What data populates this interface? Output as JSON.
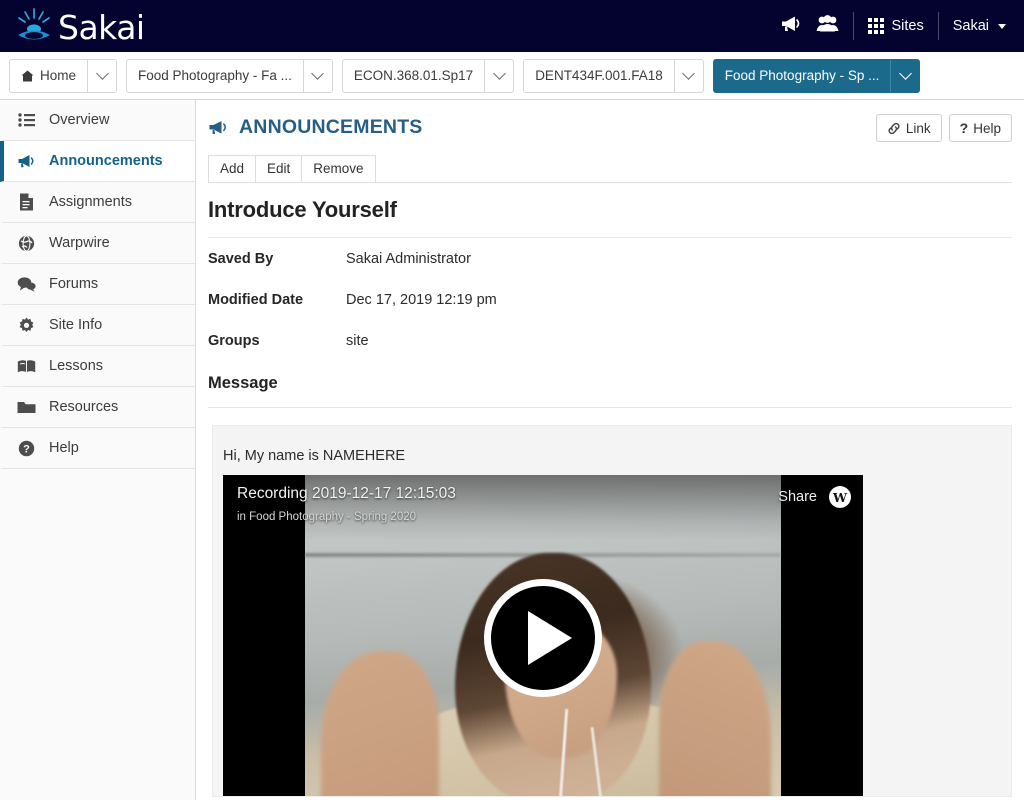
{
  "header": {
    "brand": "Sakai",
    "icons": [
      {
        "name": "announcements-icon",
        "glyph": "megaphone"
      },
      {
        "name": "groups-icon",
        "glyph": "people"
      }
    ],
    "sites_label": "Sites",
    "user_label": "Sakai"
  },
  "site_tabs": [
    {
      "label": "Home",
      "icon": "home-icon",
      "active": false
    },
    {
      "label": "Food Photography - Fa ...",
      "icon": null,
      "active": false
    },
    {
      "label": "ECON.368.01.Sp17",
      "icon": null,
      "active": false
    },
    {
      "label": "DENT434F.001.FA18",
      "icon": null,
      "active": false
    },
    {
      "label": "Food Photography - Sp ...",
      "icon": null,
      "active": true
    }
  ],
  "sidebar": {
    "items": [
      {
        "label": "Overview",
        "icon": "list-icon",
        "active": false
      },
      {
        "label": "Announcements",
        "icon": "megaphone-icon",
        "active": true
      },
      {
        "label": "Assignments",
        "icon": "document-icon",
        "active": false
      },
      {
        "label": "Warpwire",
        "icon": "globe-icon",
        "active": false
      },
      {
        "label": "Forums",
        "icon": "chat-bubbles-icon",
        "active": false
      },
      {
        "label": "Site Info",
        "icon": "gear-icon",
        "active": false
      },
      {
        "label": "Lessons",
        "icon": "book-icon",
        "active": false
      },
      {
        "label": "Resources",
        "icon": "folder-icon",
        "active": false
      },
      {
        "label": "Help",
        "icon": "question-circle-icon",
        "active": false
      }
    ]
  },
  "main": {
    "tool_title": "ANNOUNCEMENTS",
    "title_buttons": [
      {
        "label": "Link",
        "icon": "chain-link-icon"
      },
      {
        "label": "Help",
        "icon": "question-mark-icon"
      }
    ],
    "action_buttons": [
      "Add",
      "Edit",
      "Remove"
    ],
    "announcement": {
      "title": "Introduce Yourself",
      "fields": [
        {
          "label": "Saved By",
          "value": "Sakai Administrator"
        },
        {
          "label": "Modified Date",
          "value": "Dec 17, 2019 12:19 pm"
        },
        {
          "label": "Groups",
          "value": "site"
        }
      ],
      "message_heading": "Message",
      "message_text": "Hi, My name is NAMEHERE",
      "video": {
        "title": "Recording 2019-12-17 12:15:03",
        "subtitle": "in Food Photography - Spring 2020",
        "share_label": "Share",
        "provider_logo": "W",
        "play_control": "play-button"
      }
    }
  },
  "colors": {
    "header_bg": "#04022e",
    "active_tab": "#1b6a8c",
    "accent_blue": "#15618a",
    "title_blue": "#255f86",
    "message_bg": "#f4f4f4"
  }
}
